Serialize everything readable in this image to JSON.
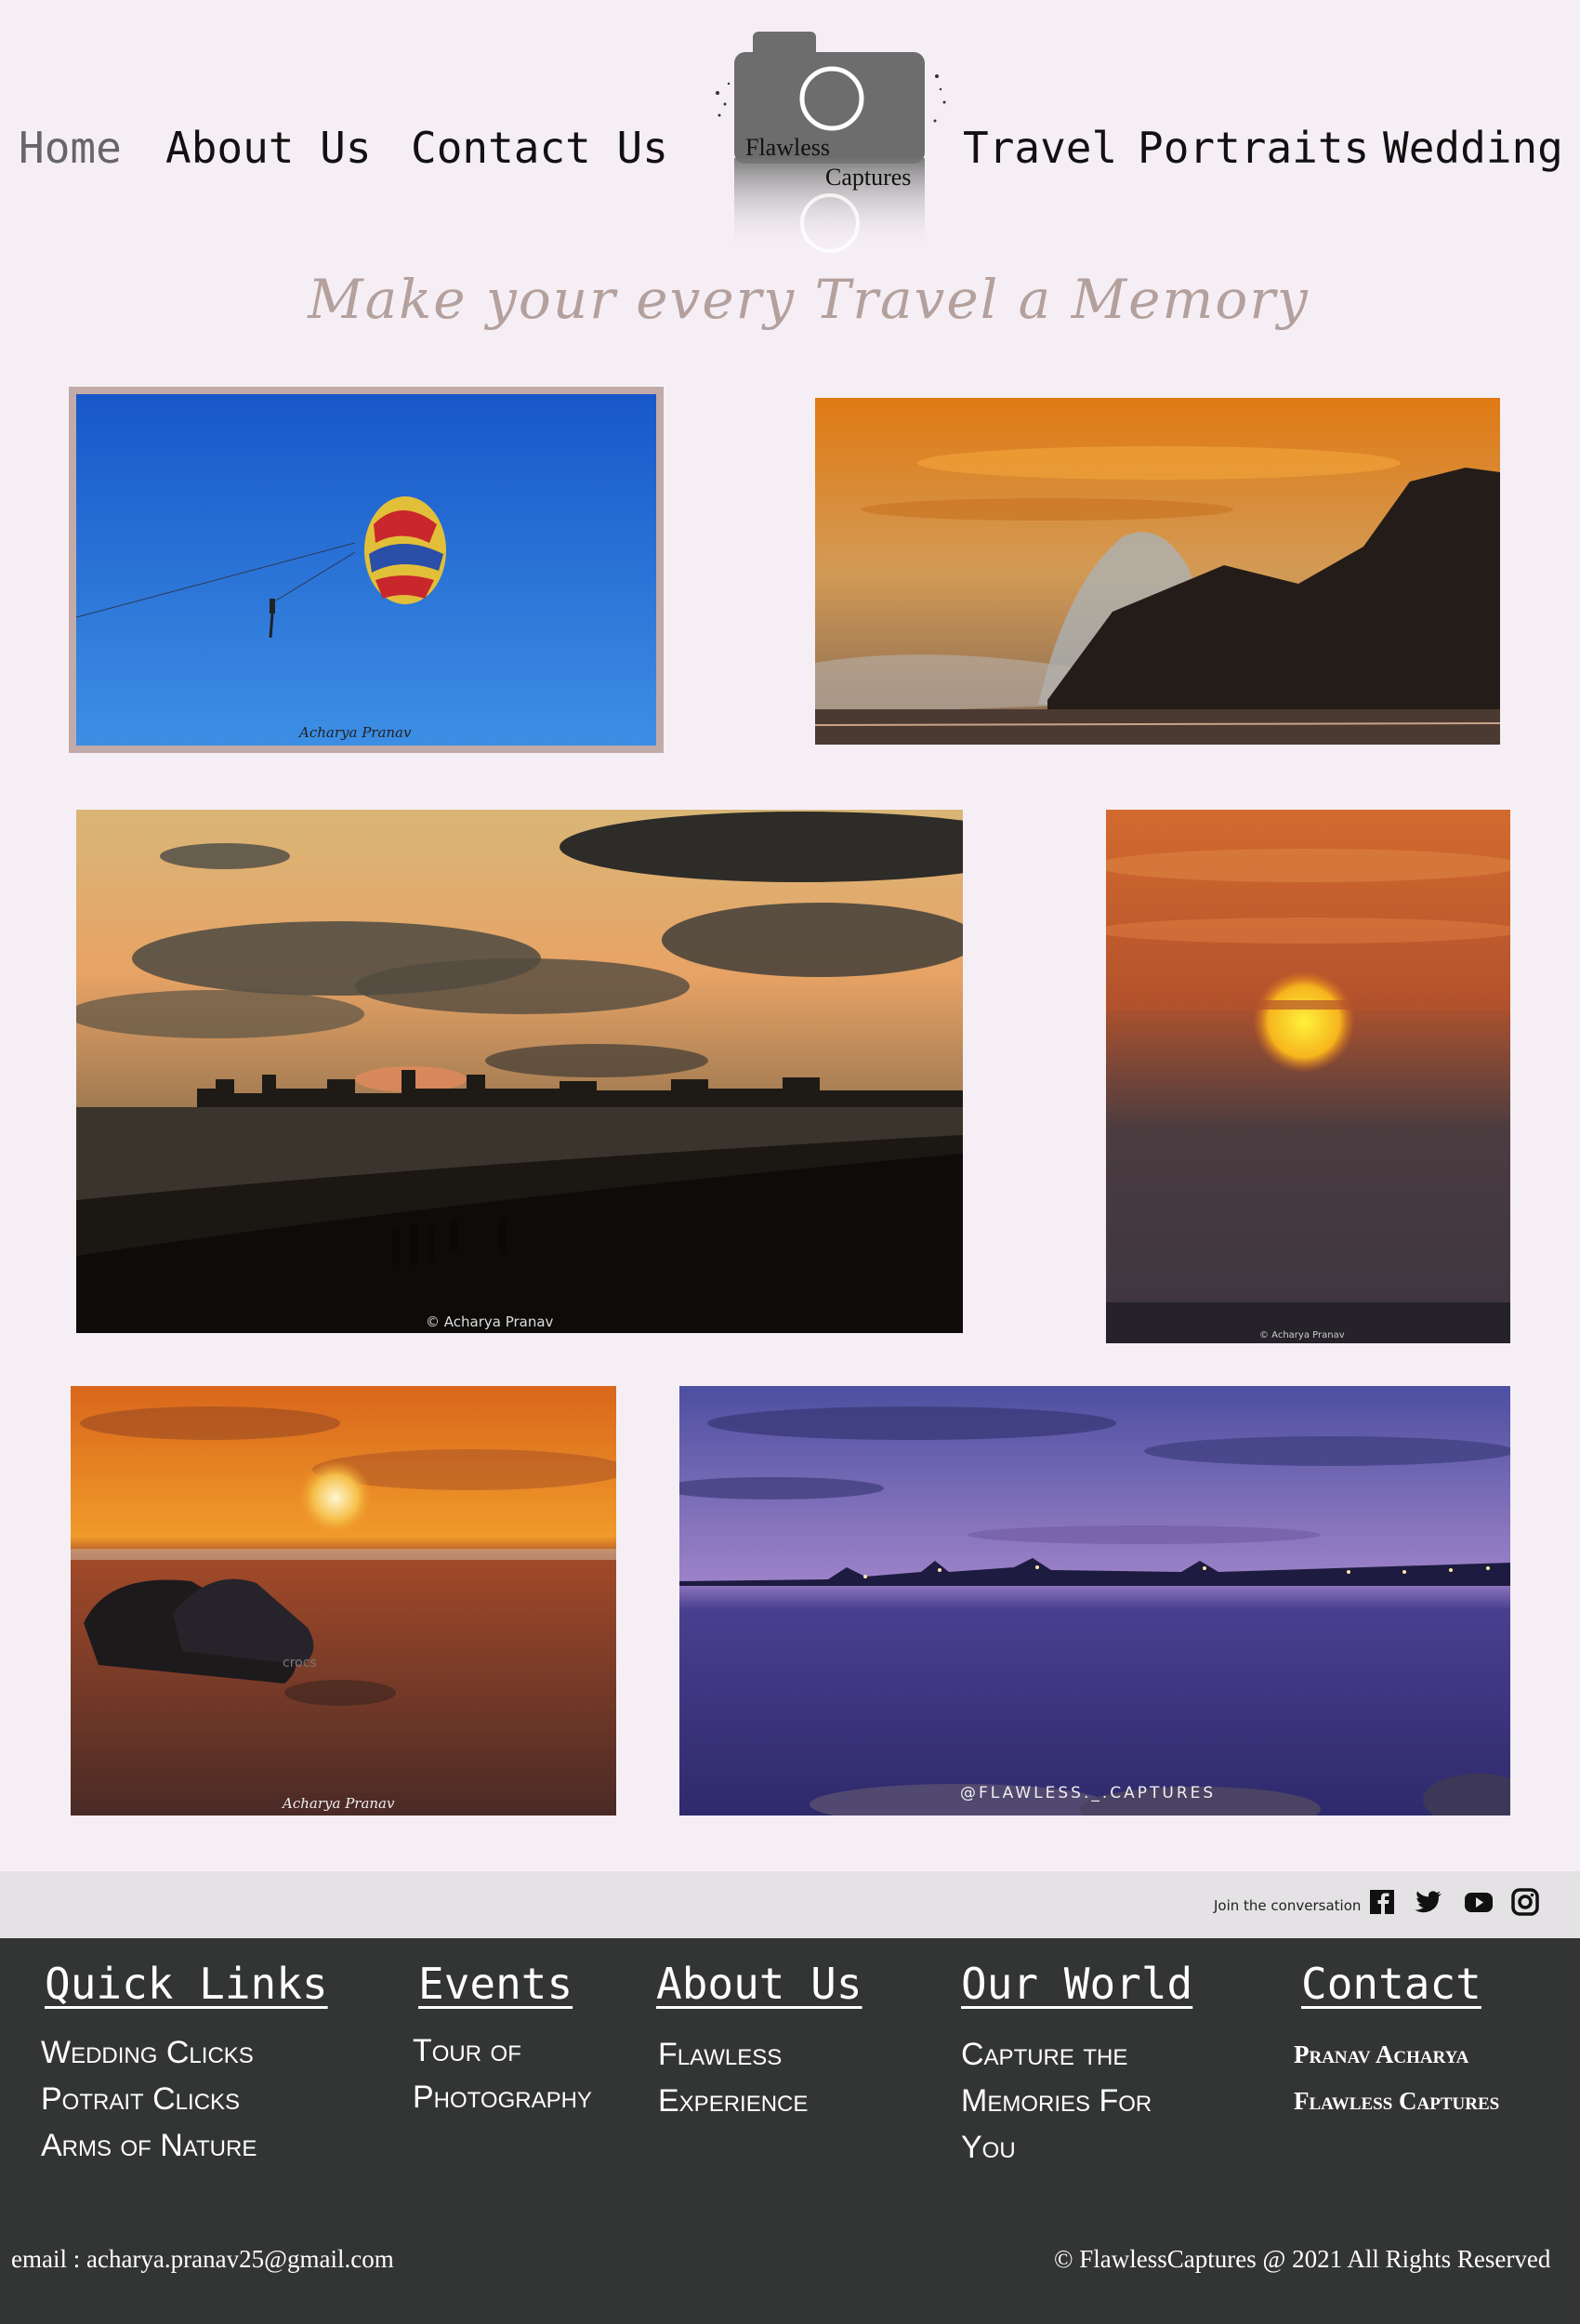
{
  "nav": {
    "home": "Home",
    "about": "About Us",
    "contact": "Contact Us",
    "travel": "Travel",
    "portraits": "Portraits",
    "wedding": "Wedding"
  },
  "logo": {
    "line1": "Flawless",
    "line2": "Captures"
  },
  "tagline": "Make your every Travel a Memory",
  "photos": {
    "parasail_credit": "Acharya Pranav",
    "skyline_credit": "© Acharya Pranav",
    "sun_credit": "© Acharya Pranav",
    "crocs_credit": "Acharya Pranav",
    "crocs_brand": "crocs",
    "purple_credit": "@FLAWLESS._.CAPTURES"
  },
  "social": {
    "join_text": "Join the conversation",
    "icons": [
      "facebook-icon",
      "twitter-icon",
      "youtube-icon",
      "instagram-icon"
    ]
  },
  "footer": {
    "quick_links": {
      "heading": "Quick Links",
      "items": [
        "Wedding Clicks",
        "Potrait Clicks",
        "Arms of Nature"
      ]
    },
    "events": {
      "heading": "Events",
      "items": [
        "Tour of",
        "Photography"
      ]
    },
    "about": {
      "heading": "About Us",
      "items": [
        "Flawless",
        "Experience"
      ]
    },
    "our_world": {
      "heading": "Our World",
      "items": [
        "Capture the",
        "Memories For",
        "You"
      ]
    },
    "contact": {
      "heading": "Contact",
      "items": [
        "Pranav Acharya",
        "Flawless Captures"
      ]
    },
    "email": "email : acharya.pranav25@gmail.com",
    "copyright": "© FlawlessCaptures @ 2021 All Rights Reserved"
  },
  "colors": {
    "page_bg": "#f5eff5",
    "footer_bg": "#333534",
    "social_bar_bg": "#e4e2e4",
    "tagline": "#b4a09c",
    "nav_active": "#666666"
  }
}
